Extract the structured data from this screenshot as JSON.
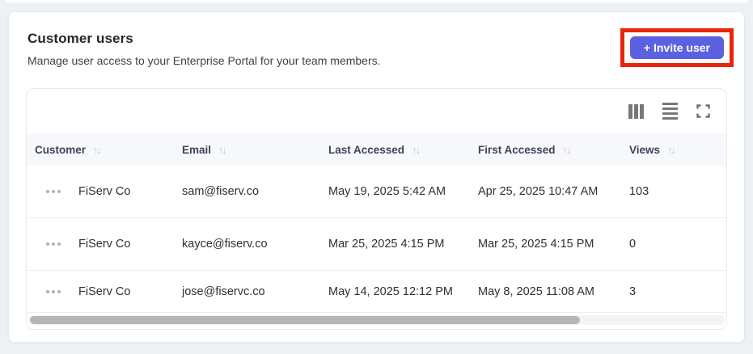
{
  "header": {
    "title": "Customer users",
    "subtitle": "Manage user access to your Enterprise Portal for your team members.",
    "invite_button_label": "+ Invite user"
  },
  "annotation": {
    "type": "highlight-box",
    "color": "#e8250c",
    "target": "invite-user-button"
  },
  "toolbar": {
    "icons": [
      "columns-icon",
      "row-density-icon",
      "fullscreen-icon"
    ]
  },
  "icons": {
    "sort_glyph": "↑↓"
  },
  "table": {
    "columns": [
      "Customer",
      "Email",
      "Last Accessed",
      "First Accessed",
      "Views"
    ],
    "rows": [
      {
        "customer": "FiServ Co",
        "email": "sam@fiserv.co",
        "last_accessed": "May 19, 2025 5:42 AM",
        "first_accessed": "Apr 25, 2025 10:47 AM",
        "views": "103"
      },
      {
        "customer": "FiServ Co",
        "email": "kayce@fiserv.co",
        "last_accessed": "Mar 25, 2025 4:15 PM",
        "first_accessed": "Mar 25, 2025 4:15 PM",
        "views": "0"
      },
      {
        "customer": "FiServ Co",
        "email": "jose@fiservc.co",
        "last_accessed": "May 14, 2025 12:12 PM",
        "first_accessed": "May 8, 2025 11:08 AM",
        "views": "3"
      }
    ]
  },
  "colors": {
    "page_background": "#edf1f4",
    "accent_button": "#5b61e0",
    "annotation_highlight": "#e8250c",
    "header_row_background": "#f7f8fc"
  }
}
